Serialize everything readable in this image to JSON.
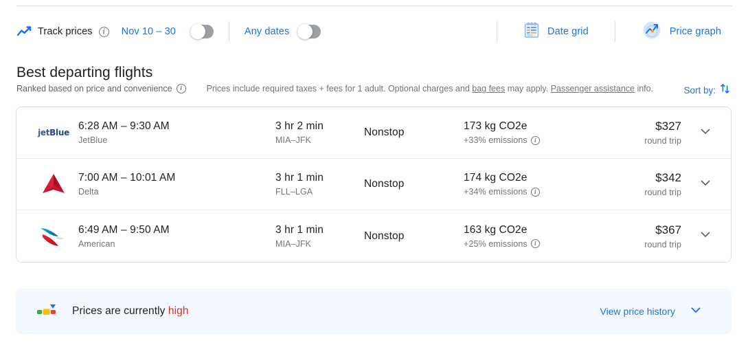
{
  "toolbar": {
    "track_prices_label": "Track prices",
    "track_prices_info": "i",
    "date_range": "Nov 10 – 30",
    "any_dates_label": "Any dates",
    "date_grid_label": "Date grid",
    "price_graph_label": "Price graph",
    "trend_icon": "trending-up-icon",
    "date_grid_icon": "calendar-grid-icon",
    "price_graph_icon": "price-graph-icon",
    "track_toggle_state": "off",
    "any_dates_toggle_state": "off"
  },
  "section": {
    "title": "Best departing flights",
    "ranked_text": "Ranked based on price and convenience",
    "ranked_info": "i",
    "disclaimer_1": "Prices include required taxes + fees for 1 adult. Optional charges and ",
    "disclaimer_link_1": "bag fees",
    "disclaimer_2": " may apply. ",
    "disclaimer_link_2": "Passenger assistance",
    "disclaimer_3": " info.",
    "sort_by_label": "Sort by:",
    "sort_icon": "sort-arrows-icon"
  },
  "flights": [
    {
      "logo": "jetblue-logo",
      "times": "6:28 AM – 9:30 AM",
      "airline": "JetBlue",
      "duration": "3 hr 2 min",
      "route": "MIA–JFK",
      "stops": "Nonstop",
      "co2": "173 kg CO2e",
      "emissions": "+33% emissions",
      "emissions_info": "i",
      "price": "$327",
      "price_type": "round trip",
      "expand_icon": "chevron-down-icon"
    },
    {
      "logo": "delta-logo",
      "times": "7:00 AM – 10:01 AM",
      "airline": "Delta",
      "duration": "3 hr 1 min",
      "route": "FLL–LGA",
      "stops": "Nonstop",
      "co2": "174 kg CO2e",
      "emissions": "+34% emissions",
      "emissions_info": "i",
      "price": "$342",
      "price_type": "round trip",
      "expand_icon": "chevron-down-icon"
    },
    {
      "logo": "american-logo",
      "times": "6:49 AM – 9:50 AM",
      "airline": "American",
      "duration": "3 hr 1 min",
      "route": "MIA–JFK",
      "stops": "Nonstop",
      "co2": "163 kg CO2e",
      "emissions": "+25% emissions",
      "emissions_info": "i",
      "price": "$367",
      "price_type": "round trip",
      "expand_icon": "chevron-down-icon"
    }
  ],
  "banner": {
    "text_prefix": "Prices are currently ",
    "level": "high",
    "view_history_label": "View price history",
    "indicator_icon": "price-level-indicator-icon",
    "expand_icon": "chevron-down-icon"
  },
  "colors": {
    "accent_blue": "#1a73e8",
    "high_red": "#d93025",
    "banner_bg": "#f3f7fe",
    "border": "#dadce0",
    "text_primary": "#202124",
    "text_secondary": "#70757a"
  }
}
